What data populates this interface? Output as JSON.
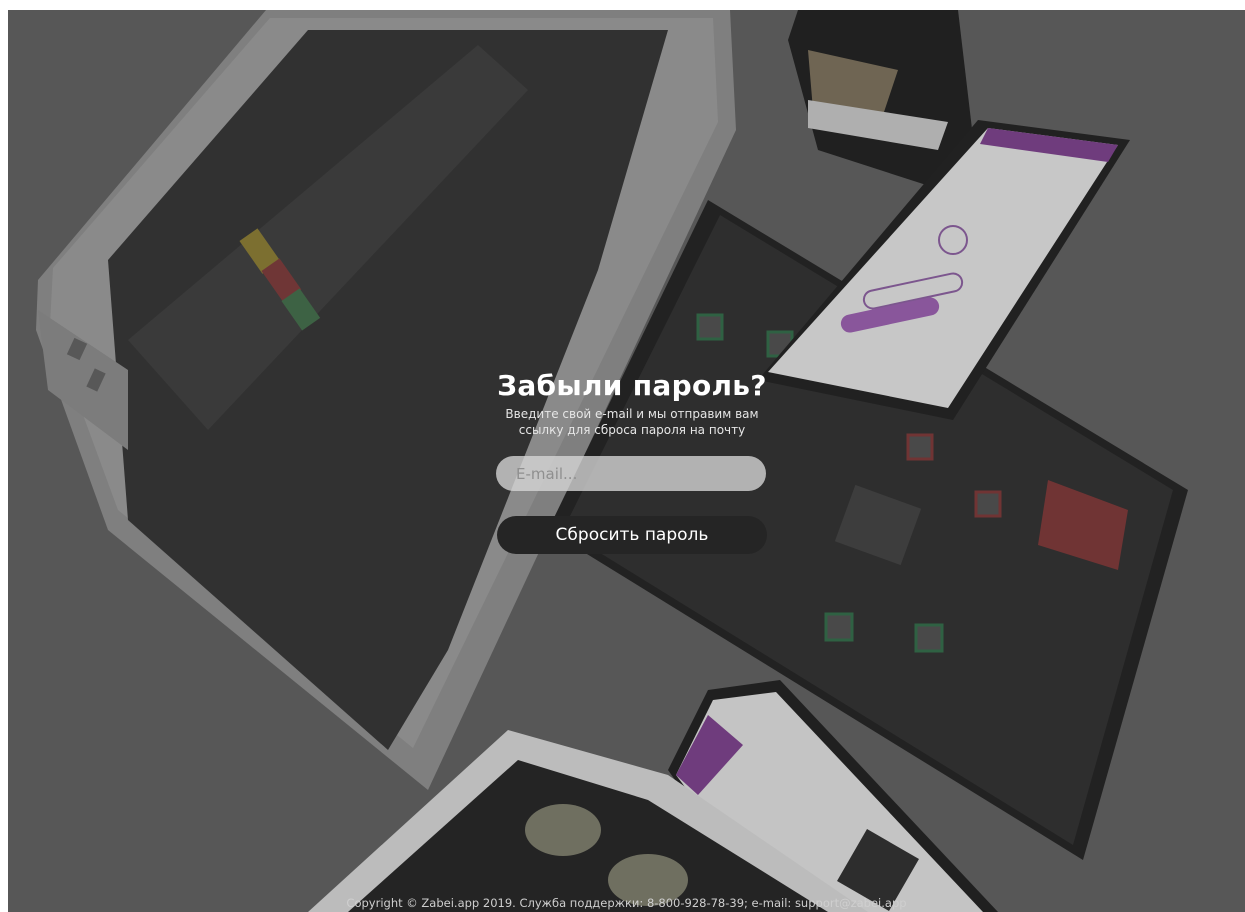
{
  "reset": {
    "title": "Забыли пароль?",
    "subtitle": "Введите свой e-mail и мы отправим вам\nссылку для сброса пароля на почту",
    "email_placeholder": "E-mail...",
    "email_value": "",
    "submit_label": "Сбросить пароль"
  },
  "footer": {
    "copyright": "Copyright © Zabei.app 2019. Служба поддержки: 8-800-928-78-39; e-mail: support@zabei.app"
  },
  "colors": {
    "background": "#5d5d5d",
    "button": "#252525",
    "input": "#d7d7d7"
  }
}
